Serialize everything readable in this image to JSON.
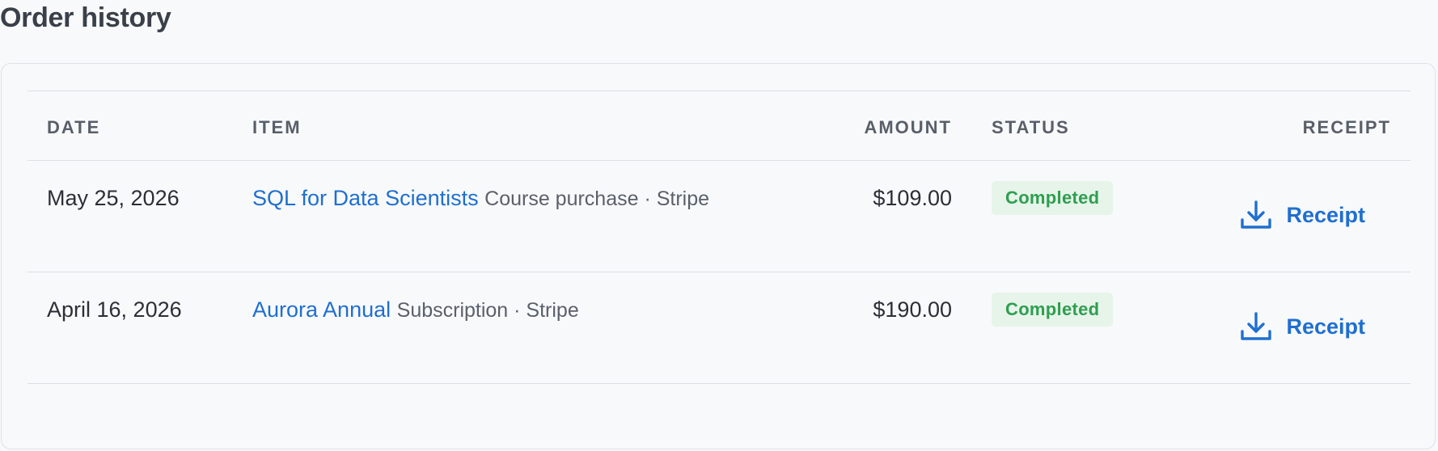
{
  "page": {
    "title": "Order history"
  },
  "table": {
    "headers": {
      "date": "DATE",
      "item": "ITEM",
      "amount": "AMOUNT",
      "status": "STATUS",
      "receipt": "RECEIPT"
    },
    "rows": [
      {
        "date": "May 25, 2026",
        "item_name": "SQL for Data Scientists",
        "item_desc": "Course purchase · Stripe",
        "amount": "$109.00",
        "status": "Completed",
        "receipt_label": "Receipt",
        "receipt_icon": "download-icon"
      },
      {
        "date": "April 16, 2026",
        "item_name": "Aurora Annual",
        "item_desc": "Subscription · Stripe",
        "amount": "$190.00",
        "status": "Completed",
        "receipt_label": "Receipt",
        "receipt_icon": "download-icon"
      }
    ]
  },
  "colors": {
    "link": "#1f6fcf",
    "status_completed_bg": "#e6f4ea",
    "status_completed_text": "#2f9e4f"
  }
}
